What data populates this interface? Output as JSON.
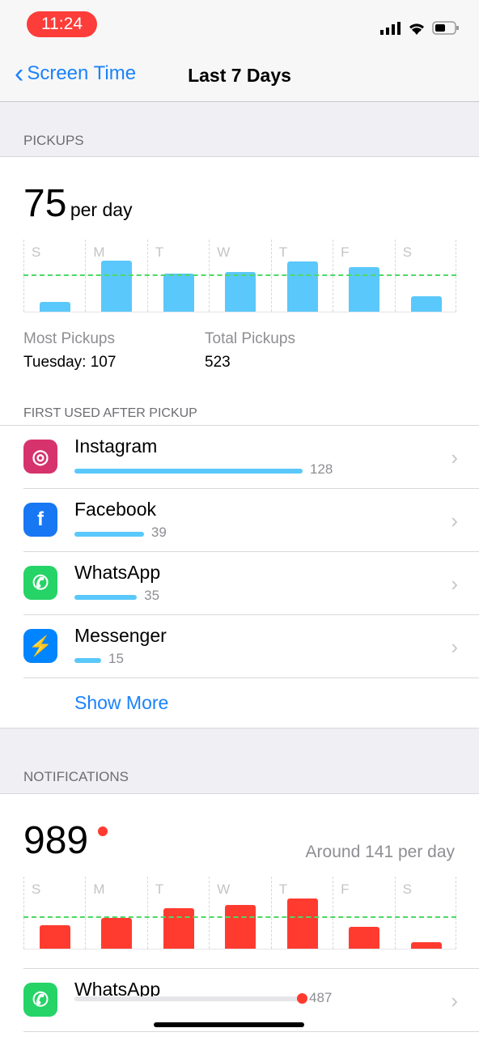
{
  "status": {
    "time": "11:24"
  },
  "nav": {
    "back_label": "Screen Time",
    "title": "Last 7 Days"
  },
  "pickups": {
    "section": "PICKUPS",
    "value": "75",
    "unit": "per day",
    "most_label": "Most Pickups",
    "most_value": "Tuesday: 107",
    "total_label": "Total Pickups",
    "total_value": "523"
  },
  "chart_data": [
    {
      "type": "bar",
      "categories": [
        "S",
        "M",
        "T",
        "W",
        "T",
        "F",
        "S"
      ],
      "values": [
        20,
        107,
        80,
        84,
        106,
        94,
        32
      ],
      "average": 75,
      "color": "#5ac8fa",
      "average_color": "#4cd964"
    },
    {
      "type": "bar",
      "categories": [
        "S",
        "M",
        "T",
        "W",
        "T",
        "F",
        "S"
      ],
      "values": [
        108,
        141,
        184,
        199,
        228,
        99,
        30
      ],
      "average": 141,
      "color": "#ff3b30",
      "average_color": "#4cd964"
    }
  ],
  "first_used": {
    "section": "FIRST USED AFTER PICKUP",
    "apps": [
      {
        "name": "Instagram",
        "value": "128",
        "count": 128,
        "icon": "instagram-icon",
        "color": "#d6336c"
      },
      {
        "name": "Facebook",
        "value": "39",
        "count": 39,
        "icon": "facebook-icon",
        "color": "#1877f2"
      },
      {
        "name": "WhatsApp",
        "value": "35",
        "count": 35,
        "icon": "whatsapp-icon",
        "color": "#25d366"
      },
      {
        "name": "Messenger",
        "value": "15",
        "count": 15,
        "icon": "messenger-icon",
        "color": "#0084ff"
      }
    ],
    "show_more": "Show More"
  },
  "notifications": {
    "section": "NOTIFICATIONS",
    "value": "989",
    "avg": "Around 141 per day",
    "apps": [
      {
        "name": "WhatsApp",
        "value": "487",
        "count": 487
      }
    ]
  }
}
